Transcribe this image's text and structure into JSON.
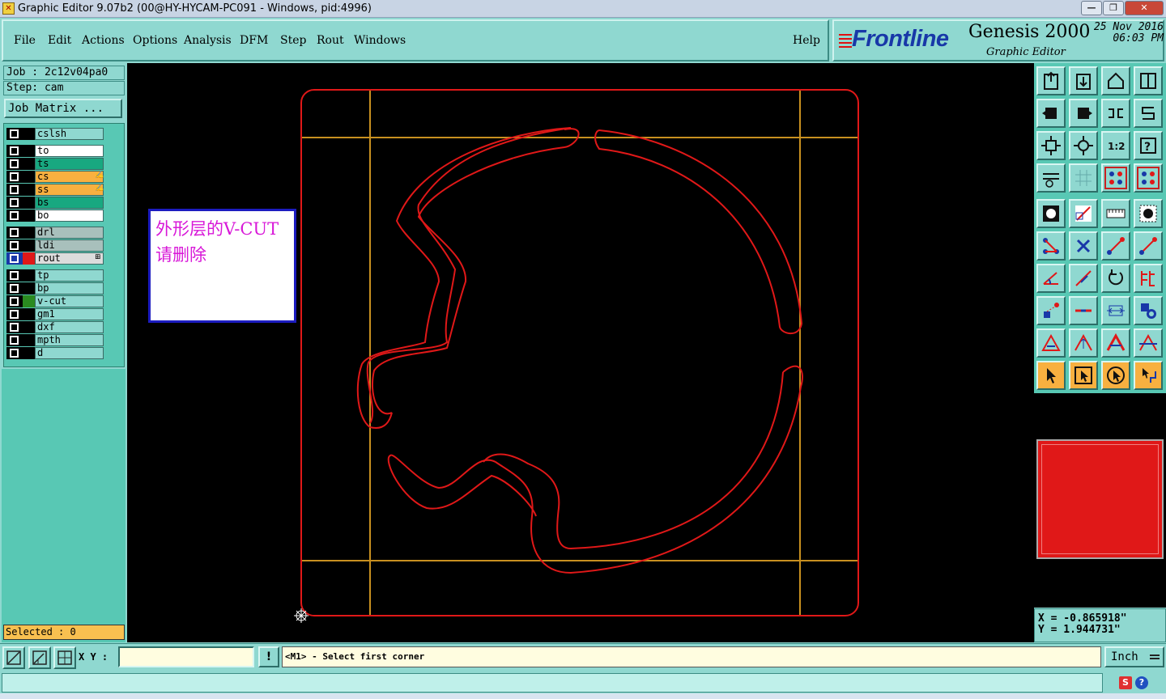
{
  "window": {
    "title": "Graphic Editor 9.07b2 (00@HY-HYCAM-PC091 - Windows, pid:4996)",
    "min": "—",
    "max": "❐",
    "close": "✕"
  },
  "menu": {
    "file": "File",
    "edit": "Edit",
    "actions": "Actions",
    "options": "Options",
    "analysis": "Analysis",
    "dfm": "DFM",
    "step": "Step",
    "rout": "Rout",
    "windows": "Windows",
    "help": "Help"
  },
  "logo": {
    "brand": "Frontline",
    "product": "Genesis 2000",
    "subtitle": "Graphic Editor",
    "date": "25 Nov 2016",
    "time": "06:03 PM"
  },
  "job": {
    "label": "Job : 2c12v04pa0",
    "step": "Step: cam",
    "matrix_button": "Job Matrix ..."
  },
  "layers": [
    {
      "name": "cslsh",
      "bg": "#8fd8d0",
      "swatch": "#000000"
    },
    {
      "name": "to",
      "bg": "#ffffff",
      "swatch": "#000000"
    },
    {
      "name": "ts",
      "bg": "#18a880",
      "swatch": "#000000"
    },
    {
      "name": "cs",
      "bg": "#f8b040",
      "swatch": "#000000",
      "mark": "✍"
    },
    {
      "name": "ss",
      "bg": "#f8b040",
      "swatch": "#000000",
      "mark": "✍"
    },
    {
      "name": "bs",
      "bg": "#18a880",
      "swatch": "#000000"
    },
    {
      "name": "bo",
      "bg": "#ffffff",
      "swatch": "#000000"
    },
    {
      "name": "drl",
      "bg": "#a8c0bc",
      "swatch": "#000000"
    },
    {
      "name": "ldi",
      "bg": "#a8c0bc",
      "swatch": "#000000"
    },
    {
      "name": "rout",
      "bg": "#dcdcdc",
      "swatch": "#e01818",
      "mark": "⊞",
      "active": true
    },
    {
      "name": "tp",
      "bg": "#8fd8d0",
      "swatch": "#000000"
    },
    {
      "name": "bp",
      "bg": "#8fd8d0",
      "swatch": "#000000"
    },
    {
      "name": "v-cut",
      "bg": "#8fd8d0",
      "swatch": "#2a8a20"
    },
    {
      "name": "gm1",
      "bg": "#8fd8d0",
      "swatch": "#000000"
    },
    {
      "name": "dxf",
      "bg": "#8fd8d0",
      "swatch": "#000000"
    },
    {
      "name": "mpth",
      "bg": "#8fd8d0",
      "swatch": "#000000"
    },
    {
      "name": "d",
      "bg": "#8fd8d0",
      "swatch": "#000000"
    }
  ],
  "selected": "Selected : 0",
  "annotation": {
    "line1": "外形层的V-CUT",
    "line2": "请删除"
  },
  "colors": {
    "outline": "#e01818",
    "vcut": "#c89020",
    "canvas": "#000000",
    "annotation_text": "#d818d8"
  },
  "toolbar_icons": [
    "home-up-icon",
    "home-down-icon",
    "home-icon",
    "window-split-icon",
    "pan-left-icon",
    "pan-right-icon",
    "mirror-icon",
    "s-curve-icon",
    "fit-screen-icon",
    "zoom-center-icon",
    "scale-1-2-icon",
    "help-icon",
    "snap-tool-icon",
    "grid-icon",
    "layer-compare-icon",
    "layer-compare-2-icon",
    "pad-icon",
    "line-draw-icon",
    "ruler-icon",
    "dot-icon",
    "connect-icon",
    "close-x-icon",
    "line-node-icon",
    "line-node-2-icon",
    "angle-icon",
    "diagonal-icon",
    "rotate-icon",
    "align-icon",
    "move-icon",
    "minus-icon",
    "measure-icon",
    "shapes-icon",
    "triangle-icon",
    "triangle-up-icon",
    "triangle-blue-icon",
    "triangle-blue-2-icon",
    "select-arrow-icon",
    "select-box-icon",
    "select-circle-icon",
    "select-path-icon"
  ],
  "coords": {
    "x": "X = -0.865918\"",
    "y": "Y = 1.944731\""
  },
  "bottom": {
    "xy_label": "X Y :",
    "xy_value": "",
    "prompt": "<M1> - Select first corner",
    "unit": "Inch",
    "exclaim": "!"
  },
  "tray": {
    "s": "S",
    "help": "?"
  }
}
